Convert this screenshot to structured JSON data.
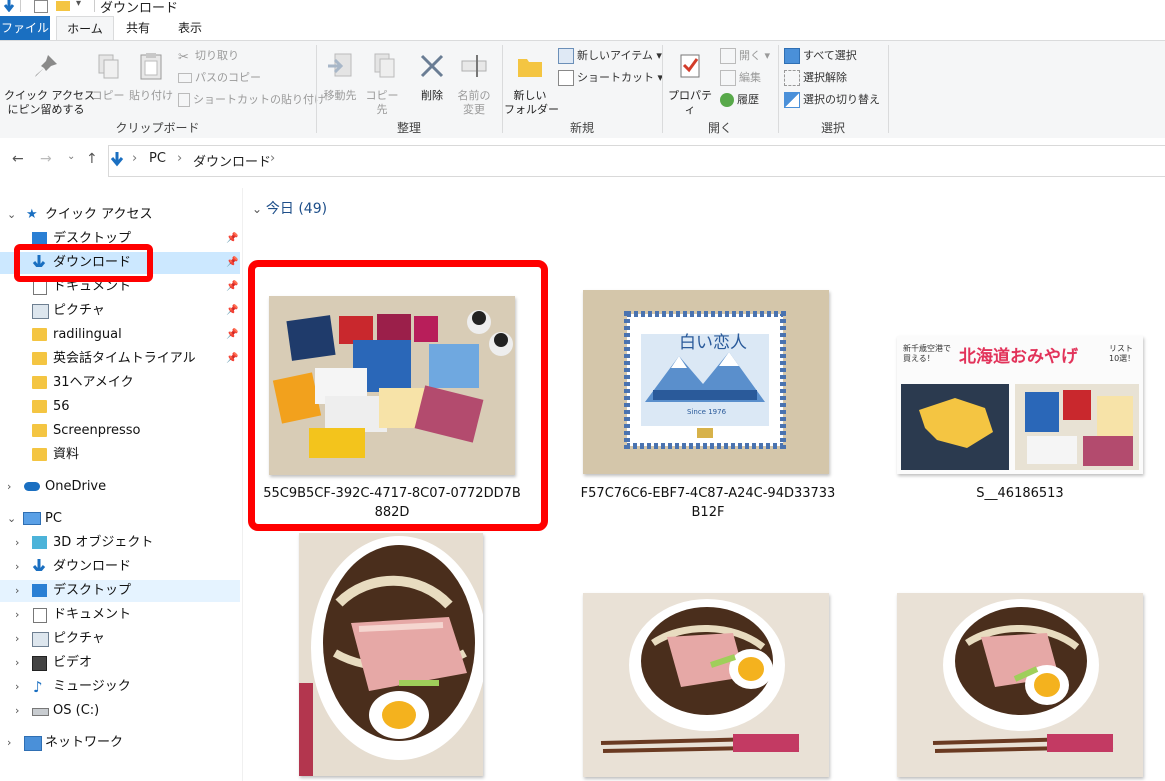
{
  "window": {
    "title": "ダウンロード"
  },
  "tabs": {
    "file": "ファイル",
    "home": "ホーム",
    "share": "共有",
    "view": "表示"
  },
  "ribbon": {
    "clipboard": {
      "pin_quick": "クイック アクセス\nにピン留めする",
      "copy": "コピー",
      "paste": "貼り付け",
      "cut": "切り取り",
      "copy_path": "パスのコピー",
      "paste_shortcut": "ショートカットの貼り付け",
      "label": "クリップボード"
    },
    "organize": {
      "move_to": "移動先",
      "copy_to": "コピー先",
      "delete": "削除",
      "rename": "名前の\n変更",
      "label": "整理"
    },
    "new": {
      "new_folder": "新しい\nフォルダー",
      "new_item": "新しいアイテム",
      "shortcut": "ショートカット",
      "label": "新規"
    },
    "open": {
      "properties": "プロパティ",
      "open": "開く",
      "edit": "編集",
      "history": "履歴",
      "label": "開く"
    },
    "select": {
      "select_all": "すべて選択",
      "select_none": "選択解除",
      "invert": "選択の切り替え",
      "label": "選択"
    }
  },
  "address": {
    "crumbs": [
      "PC",
      "ダウンロード"
    ]
  },
  "sidebar": {
    "quick_access": "クイック アクセス",
    "quick_items": [
      "デスクトップ",
      "ダウンロード",
      "ドキュメント",
      "ピクチャ",
      "radilingual",
      "英会話タイムトライアル",
      "31ヘアメイク",
      "56",
      "Screenpresso",
      "資料"
    ],
    "onedrive": "OneDrive",
    "pc": "PC",
    "pc_items": [
      "3D オブジェクト",
      "ダウンロード",
      "デスクトップ",
      "ドキュメント",
      "ピクチャ",
      "ビデオ",
      "ミュージック",
      "OS (C:)"
    ],
    "network": "ネットワーク"
  },
  "content": {
    "group_header": "今日 (49)",
    "files": [
      "55C9B5CF-392C-4717-8C07-0772DD7B882D",
      "F57C76C6-EBF7-4C87-A24C-94D33733B12F",
      "S__46186513"
    ],
    "file_lines": [
      [
        "55C9B5CF-392C-4717-8C07-0772DD7B",
        "882D"
      ],
      [
        "F57C76C6-EBF7-4C87-A24C-94D33733",
        "B12F"
      ],
      [
        "S__46186513"
      ]
    ],
    "thumb_texts": {
      "box_brand": "白い恋人",
      "box_since": "Since 1976",
      "banner_title": "北海道おみやげ",
      "banner_sub": "新千歳空港で買える！",
      "banner_tail": "リスト10選！"
    }
  },
  "colors": {
    "accent": "#1a6fc1",
    "selection": "#cce8ff",
    "highlight_red": "#ff0000"
  }
}
